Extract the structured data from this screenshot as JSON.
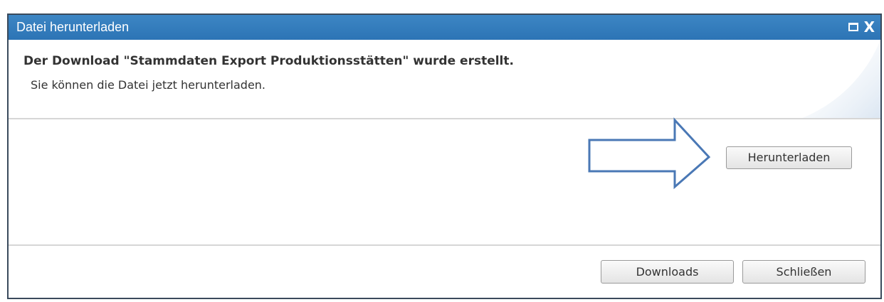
{
  "dialog": {
    "title": "Datei herunterladen",
    "controls": {
      "maximize_icon": "maximize-icon",
      "close_icon": "close-icon",
      "close_glyph": "X"
    },
    "message": {
      "headline": "Der Download \"Stammdaten Export Produktionsstätten\" wurde erstellt.",
      "subline": "Sie können die Datei jetzt herunterladen."
    },
    "download_button_label": "Herunterladen",
    "footer": {
      "downloads_button_label": "Downloads",
      "close_button_label": "Schließen"
    }
  },
  "annotation": {
    "icon": "right-arrow-icon",
    "color": "#4a78b5"
  },
  "colors": {
    "titlebar": "#2f77b8",
    "border": "#3a4a5c",
    "text": "#333333",
    "divider": "#d6d6d6"
  }
}
